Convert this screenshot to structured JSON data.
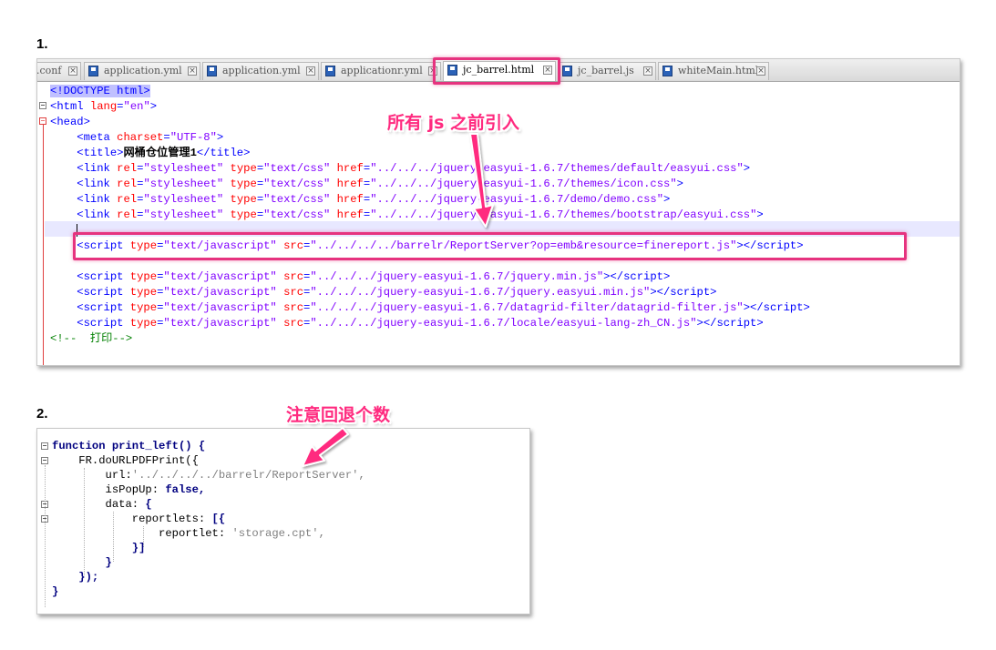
{
  "step1": "1.",
  "step2": "2.",
  "tabs": [
    {
      "label": ".conf",
      "active": false
    },
    {
      "label": "application.yml",
      "active": false
    },
    {
      "label": "application.yml",
      "active": false
    },
    {
      "label": "applicationr.yml",
      "active": false
    },
    {
      "label": "jc_barrel.html",
      "active": true
    },
    {
      "label": "jc_barrel.js",
      "active": false
    },
    {
      "label": "whiteMain.html",
      "active": false
    }
  ],
  "annotations": {
    "js_before": "所有 js 之前引入",
    "note_back": "注意回退个数"
  },
  "html_code": {
    "doctype": "<!DOCTYPE html>",
    "html_open": "<html",
    "lang_attr": "lang",
    "lang_val": "\"en\"",
    "head_open": "<head>",
    "meta_open": "<meta",
    "charset_attr": "charset",
    "charset_val": "\"UTF-8\"",
    "title_open": "<title>",
    "title_text": "网桶仓位管理1",
    "title_close": "</title>",
    "links": [
      "\"../../../jquery-easyui-1.6.7/themes/default/easyui.css\"",
      "\"../../../jquery-easyui-1.6.7/themes/icon.css\"",
      "\"../../../jquery-easyui-1.6.7/demo/demo.css\"",
      "\"../../../jquery-easyui-1.6.7/themes/bootstrap/easyui.css\""
    ],
    "fr_script_src": "\"../../../../barrelr/ReportServer?op=emb&resource=finereport.js\"",
    "scripts": [
      "\"../../../jquery-easyui-1.6.7/jquery.min.js\"",
      "\"../../../jquery-easyui-1.6.7/jquery.easyui.min.js\"",
      "\"../../../jquery-easyui-1.6.7/datagrid-filter/datagrid-filter.js\"",
      "\"../../../jquery-easyui-1.6.7/locale/easyui-lang-zh_CN.js\""
    ],
    "comment": "<!--  打印-->"
  },
  "js_code": {
    "line1_kw": "function",
    "line1_rest": " print_left() {",
    "line2": "FR.doURLPDFPrint({",
    "url_key": "url:",
    "url_val": "'../../../../barrelr/ReportServer',",
    "popup_key": "isPopUp:",
    "popup_val": " false,",
    "data_key": "data:",
    "data_brace": " {",
    "reportlets_key": "reportlets:",
    "reportlets_open": " [{",
    "reportlet_key": "reportlet:",
    "reportlet_val": " 'storage.cpt',",
    "close1": "}]",
    "close2": "}",
    "close3": "});",
    "close4": "}"
  },
  "colors": {
    "highlight": "#e6337f",
    "annotation": "#ff2a7f",
    "tag": "#0000ff",
    "attr": "#ff0000",
    "value": "#8000ff"
  }
}
